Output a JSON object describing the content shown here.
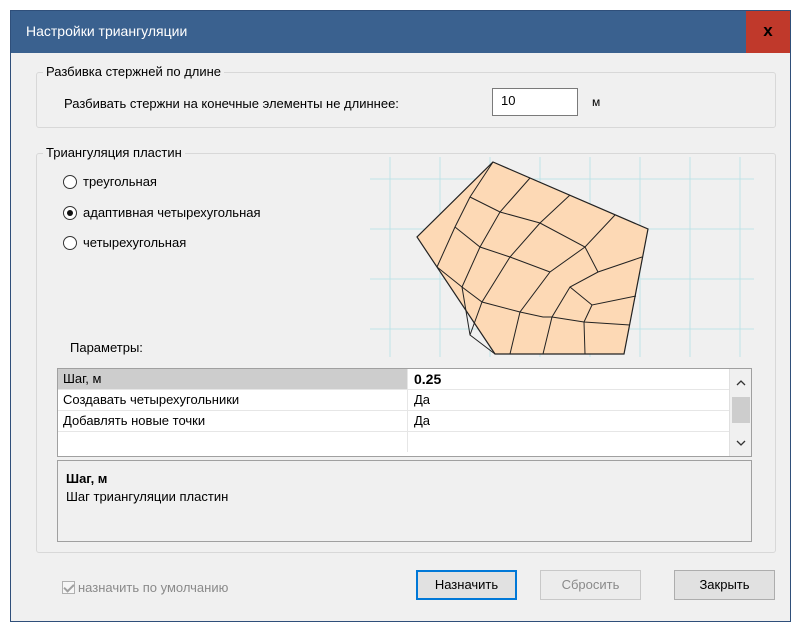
{
  "window": {
    "title": "Настройки триангуляции",
    "close_label": "x"
  },
  "segmentation": {
    "group_title": "Разбивка стержней по длине",
    "label": "Разбивать стержни на конечные элементы не длиннее:",
    "value": "10",
    "unit": "м"
  },
  "triangulation": {
    "group_title": "Триангуляция пластин",
    "options": [
      {
        "label": "треугольная",
        "selected": false
      },
      {
        "label": "адаптивная четырехугольная",
        "selected": true
      },
      {
        "label": "четырехугольная",
        "selected": false
      }
    ],
    "params_label": "Параметры:"
  },
  "params": [
    {
      "name": "Шаг, м",
      "value": "0.25"
    },
    {
      "name": "Создавать четырехугольники",
      "value": "Да"
    },
    {
      "name": "Добавлять новые точки",
      "value": "Да"
    }
  ],
  "description": {
    "title": "Шаг, м",
    "text": "Шаг триангуляции пластин"
  },
  "footer": {
    "default_checkbox_label": "назначить по умолчанию",
    "assign_label": "Назначить",
    "reset_label": "Сбросить",
    "close_label": "Закрыть"
  },
  "icons": {
    "close": "close-icon",
    "scroll_up": "chevron-up-icon",
    "scroll_down": "chevron-down-icon",
    "check": "check-icon"
  },
  "colors": {
    "titlebar": "#3a618f",
    "close_button": "#c0392b",
    "mesh_fill": "#fdd9b5",
    "mesh_grid": "#bfe3e8"
  }
}
